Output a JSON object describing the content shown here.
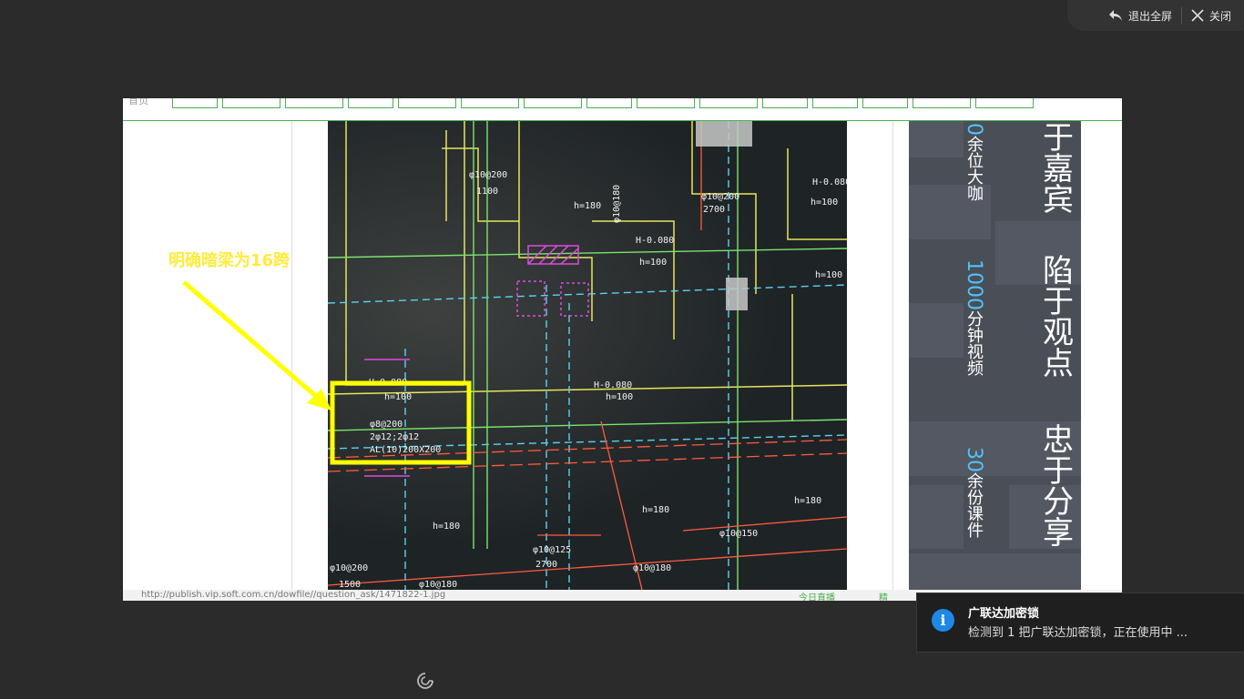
{
  "topbar": {
    "exit_fullscreen_label": "退出全屏",
    "close_label": "关闭"
  },
  "screenshot": {
    "breadcrumb": "首页",
    "annotation_text": "明确暗梁为16跨",
    "status_url": "http://publish.vip.soft.com.cn/dowfile//question_ask/1471822-1.jpg",
    "status_live": "今日直播",
    "status_more": "精",
    "drawing_labels": {
      "l1": "φ10@200",
      "l2": "1100",
      "l3": "h=180",
      "l4": "φ10@180",
      "l5": "H-0.080",
      "l6": "h=100",
      "l7": "φ8@200",
      "l8": "2φ12;2φ12",
      "l9": "AL(10)200X200",
      "l10": "h=180",
      "l11": "φ10@200",
      "l12": "1500",
      "l13": "φ10@180",
      "l14": "φ10@125",
      "l15": "2700",
      "l16": "h=180",
      "l17": "φ10@150",
      "l18": "φ10@180",
      "l19": "H-0.080",
      "l20": "h=100",
      "l21": "h=180",
      "l22": "H-0.080",
      "l23": "h=100",
      "l24": "φ10@200",
      "l25": "2700",
      "l26": "h=100",
      "l27": "H-0.080",
      "l28": "h=100"
    },
    "ad": {
      "big1": "于嘉宾",
      "big2": "陷于观点",
      "big3": "忠于分享",
      "num1": "0",
      "small1": "余位大咖",
      "num2": "1000",
      "small2": "分钟视频",
      "num3": "30",
      "small3": "余份课件"
    }
  },
  "toast": {
    "title": "广联达加密锁",
    "message": "检测到 1 把广联达加密锁，正在使用中 ..."
  },
  "colors": {
    "background": "#2b2b2b",
    "accent_green": "#4caf50",
    "annotation_yellow": "#ffeb3b",
    "info_blue": "#1e88e5",
    "ad_number_blue": "#4fc3f7"
  }
}
